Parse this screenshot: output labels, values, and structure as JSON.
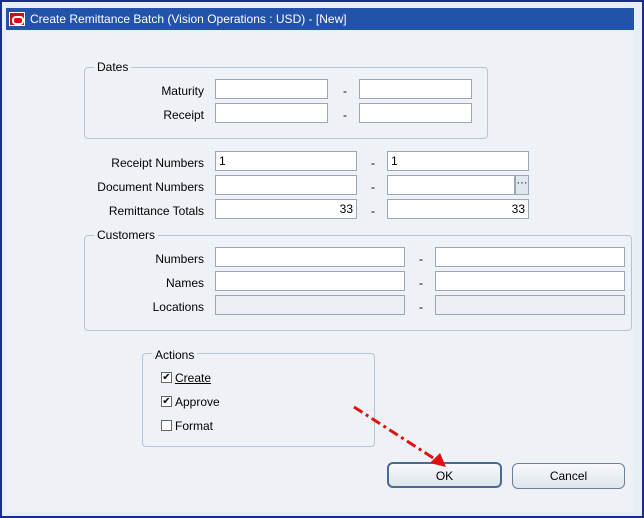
{
  "window": {
    "title": "Create Remittance Batch (Vision Operations : USD) - [New]"
  },
  "dates": {
    "group_label": "Dates",
    "maturity_label": "Maturity",
    "receipt_label": "Receipt",
    "maturity_from": "",
    "maturity_to": "",
    "receipt_from": "",
    "receipt_to": ""
  },
  "receipt_numbers": {
    "label": "Receipt Numbers",
    "from": "1",
    "to": "1"
  },
  "document_numbers": {
    "label": "Document Numbers",
    "from": "",
    "to": "",
    "lov": "···"
  },
  "remittance_totals": {
    "label": "Remittance Totals",
    "from": "33",
    "to": "33"
  },
  "customers": {
    "group_label": "Customers",
    "numbers_label": "Numbers",
    "names_label": "Names",
    "locations_label": "Locations",
    "numbers_from": "",
    "numbers_to": "",
    "names_from": "",
    "names_to": "",
    "locations_from": "",
    "locations_to": ""
  },
  "range_separator": "-",
  "actions": {
    "group_label": "Actions",
    "create": {
      "label": "Create",
      "checked": true
    },
    "approve": {
      "label": "Approve",
      "checked": true
    },
    "format": {
      "label": "Format",
      "checked": false
    }
  },
  "buttons": {
    "ok": "OK",
    "cancel": "Cancel"
  },
  "colors": {
    "title_bar": "#2253a8",
    "annotation_arrow": "#e01010"
  }
}
